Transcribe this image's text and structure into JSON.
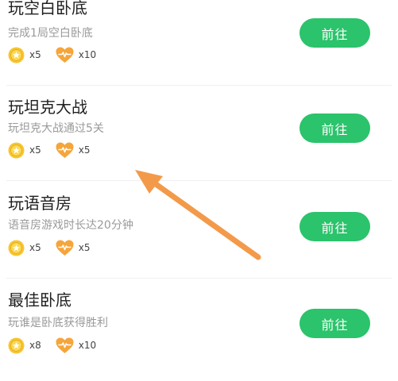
{
  "tasks": [
    {
      "title": "玩空白卧底",
      "desc": "完成1局空白卧底",
      "rewards": [
        {
          "icon": "coin-icon",
          "count": "x5"
        },
        {
          "icon": "heart-icon",
          "count": "x10"
        }
      ],
      "button": "前往"
    },
    {
      "title": "玩坦克大战",
      "desc": "玩坦克大战通过5关",
      "rewards": [
        {
          "icon": "coin-icon",
          "count": "x5"
        },
        {
          "icon": "heart-icon",
          "count": "x5"
        }
      ],
      "button": "前往"
    },
    {
      "title": "玩语音房",
      "desc": "语音房游戏时长达20分钟",
      "rewards": [
        {
          "icon": "coin-icon",
          "count": "x5"
        },
        {
          "icon": "heart-icon",
          "count": "x5"
        }
      ],
      "button": "前往"
    },
    {
      "title": "最佳卧底",
      "desc": "玩谁是卧底获得胜利",
      "rewards": [
        {
          "icon": "coin-icon",
          "count": "x8"
        },
        {
          "icon": "heart-icon",
          "count": "x10"
        }
      ],
      "button": "前往"
    }
  ],
  "colors": {
    "button_bg": "#2bc36b",
    "button_text": "#ffffff",
    "arrow": "#f39a4a",
    "coin": "#f7c631",
    "heart": "#f5a53a"
  }
}
